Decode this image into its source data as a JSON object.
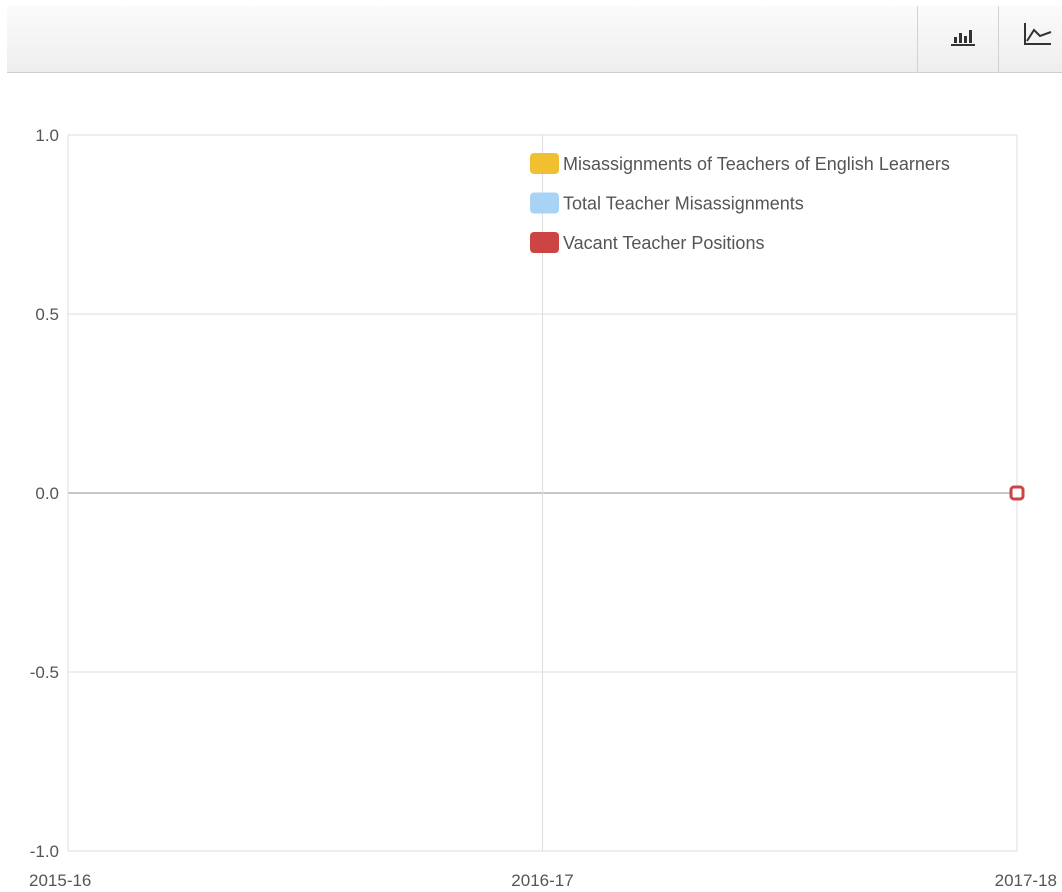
{
  "toolbar": {
    "bar_icon": "bar-chart-icon",
    "line_icon": "line-chart-icon"
  },
  "chart_data": {
    "type": "line",
    "x": [
      "2015-16",
      "2016-17",
      "2017-18"
    ],
    "ylim": [
      -1.0,
      1.0
    ],
    "yticks": [
      "1.0",
      "0.5",
      "0.0",
      "-0.5",
      "-1.0"
    ],
    "grid": true,
    "legend_position": "top-right",
    "series": [
      {
        "name": "Misassignments of Teachers of English Learners",
        "color": "#f0c030",
        "values": [
          null,
          null,
          0
        ]
      },
      {
        "name": "Total Teacher Misassignments",
        "color": "#a9d3f5",
        "values": [
          null,
          null,
          0
        ]
      },
      {
        "name": "Vacant Teacher Positions",
        "color": "#cc4444",
        "values": [
          null,
          null,
          0
        ]
      }
    ]
  }
}
